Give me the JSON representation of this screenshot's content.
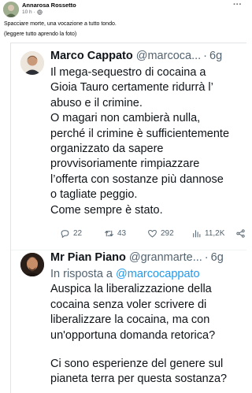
{
  "post": {
    "author": "Annarosa Rossetto",
    "time": "10 h",
    "separator": "·",
    "more_label": "···",
    "text_line1": "Spacciare morte, una vocazione a tutto tondo.",
    "text_line2": "(leggere tutto aprendo la foto)"
  },
  "tweets": [
    {
      "name": "Marco Cappato",
      "handle": "@marcoca...",
      "dot": "·",
      "time": "6g",
      "lines": [
        "Il mega-sequestro di cocaina a",
        "Gioia Tauro certamente ridurrà l’",
        "abuso e il crimine.",
        "O magari non cambierà nulla,",
        "perché il crimine è sufficientemente",
        "organizzato da sapere",
        "provvisoriamente rimpiazzare",
        "l’offerta con sostanze più dannose",
        "o tagliate peggio.",
        "Come sempre è stato."
      ],
      "stats": {
        "replies": "22",
        "retweets": "43",
        "likes": "292",
        "views": "11,2K"
      }
    },
    {
      "name": "Mr Pian Piano",
      "handle": "@granmarte...",
      "dot": "·",
      "time": "6g",
      "reply_prefix": "In risposta a ",
      "reply_mention": "@marcocappato",
      "lines": [
        "Auspica la liberalizzazione della",
        "cocaina senza voler scrivere di",
        "liberalizzare la cocaina, ma con",
        "un'opportuna domanda retorica?"
      ],
      "lines2": [
        "Ci sono esperienze del genere sul",
        "pianeta terra per questa sostanza?"
      ]
    }
  ],
  "colors": {
    "accent": "#1d9bf0",
    "secondary_text": "#536471",
    "primary_text": "#0f1419"
  }
}
